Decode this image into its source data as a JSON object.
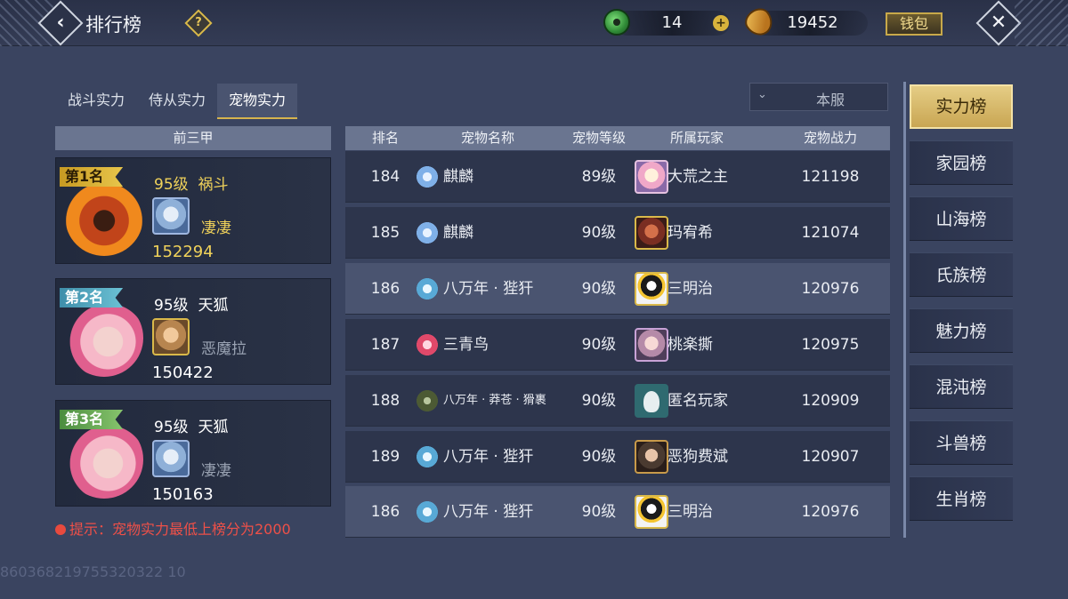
{
  "topbar": {
    "back_glyph": "‹",
    "title": "排行榜",
    "help_glyph": "?",
    "jade_count": "14",
    "plus_glyph": "+",
    "coin_count": "19452",
    "wallet_label": "钱包",
    "close_glyph": "✕"
  },
  "tabs": [
    {
      "label": "战斗实力",
      "active": false
    },
    {
      "label": "侍从实力",
      "active": false
    },
    {
      "label": "宠物实力",
      "active": true
    }
  ],
  "server_filter": {
    "chevron": "⌄",
    "selected": "本服"
  },
  "top_three": {
    "header": "前三甲",
    "cards": [
      {
        "rank_label": "第1名",
        "level": "95级",
        "pet_name": "祸斗",
        "owner": "凄凄",
        "power": "152294"
      },
      {
        "rank_label": "第2名",
        "level": "95级",
        "pet_name": "天狐",
        "owner": "恶魔拉",
        "power": "150422"
      },
      {
        "rank_label": "第3名",
        "level": "95级",
        "pet_name": "天狐",
        "owner": "凄凄",
        "power": "150163"
      }
    ],
    "tip": "提示：宠物实力最低上榜分为2000"
  },
  "table": {
    "headers": {
      "rank": "排名",
      "pet_name": "宠物名称",
      "pet_level": "宠物等级",
      "owner": "所属玩家",
      "power": "宠物战力"
    },
    "rows": [
      {
        "rank": "184",
        "pet_name": "麒麟",
        "pet_level": "89级",
        "owner": "大荒之主",
        "power": "121198"
      },
      {
        "rank": "185",
        "pet_name": "麒麟",
        "pet_level": "90级",
        "owner": "玛宥希",
        "power": "121074"
      },
      {
        "rank": "186",
        "pet_name": "八万年 · 狴犴",
        "pet_level": "90级",
        "owner": "三明治",
        "power": "120976"
      },
      {
        "rank": "187",
        "pet_name": "三青鸟",
        "pet_level": "90级",
        "owner": "桃楽撕",
        "power": "120975"
      },
      {
        "rank": "188",
        "pet_name": "八万年 · 莽苍 · 猾裹",
        "pet_level": "90级",
        "owner": "匿名玩家",
        "power": "120909"
      },
      {
        "rank": "189",
        "pet_name": "八万年 · 狴犴",
        "pet_level": "90级",
        "owner": "恶狗费斌",
        "power": "120907"
      }
    ],
    "my_row": {
      "rank": "186",
      "pet_name": "八万年 · 狴犴",
      "pet_level": "90级",
      "owner": "三明治",
      "power": "120976"
    }
  },
  "categories": [
    {
      "label": "实力榜",
      "active": true
    },
    {
      "label": "家园榜",
      "active": false
    },
    {
      "label": "山海榜",
      "active": false
    },
    {
      "label": "氏族榜",
      "active": false
    },
    {
      "label": "魅力榜",
      "active": false
    },
    {
      "label": "混沌榜",
      "active": false
    },
    {
      "label": "斗兽榜",
      "active": false
    },
    {
      "label": "生肖榜",
      "active": false
    }
  ],
  "watermark": "860368219755320322 10",
  "colors": {
    "accent_gold": "#d6b44e",
    "tip_red": "#ee5048",
    "panel_bg": "#3a4460"
  }
}
